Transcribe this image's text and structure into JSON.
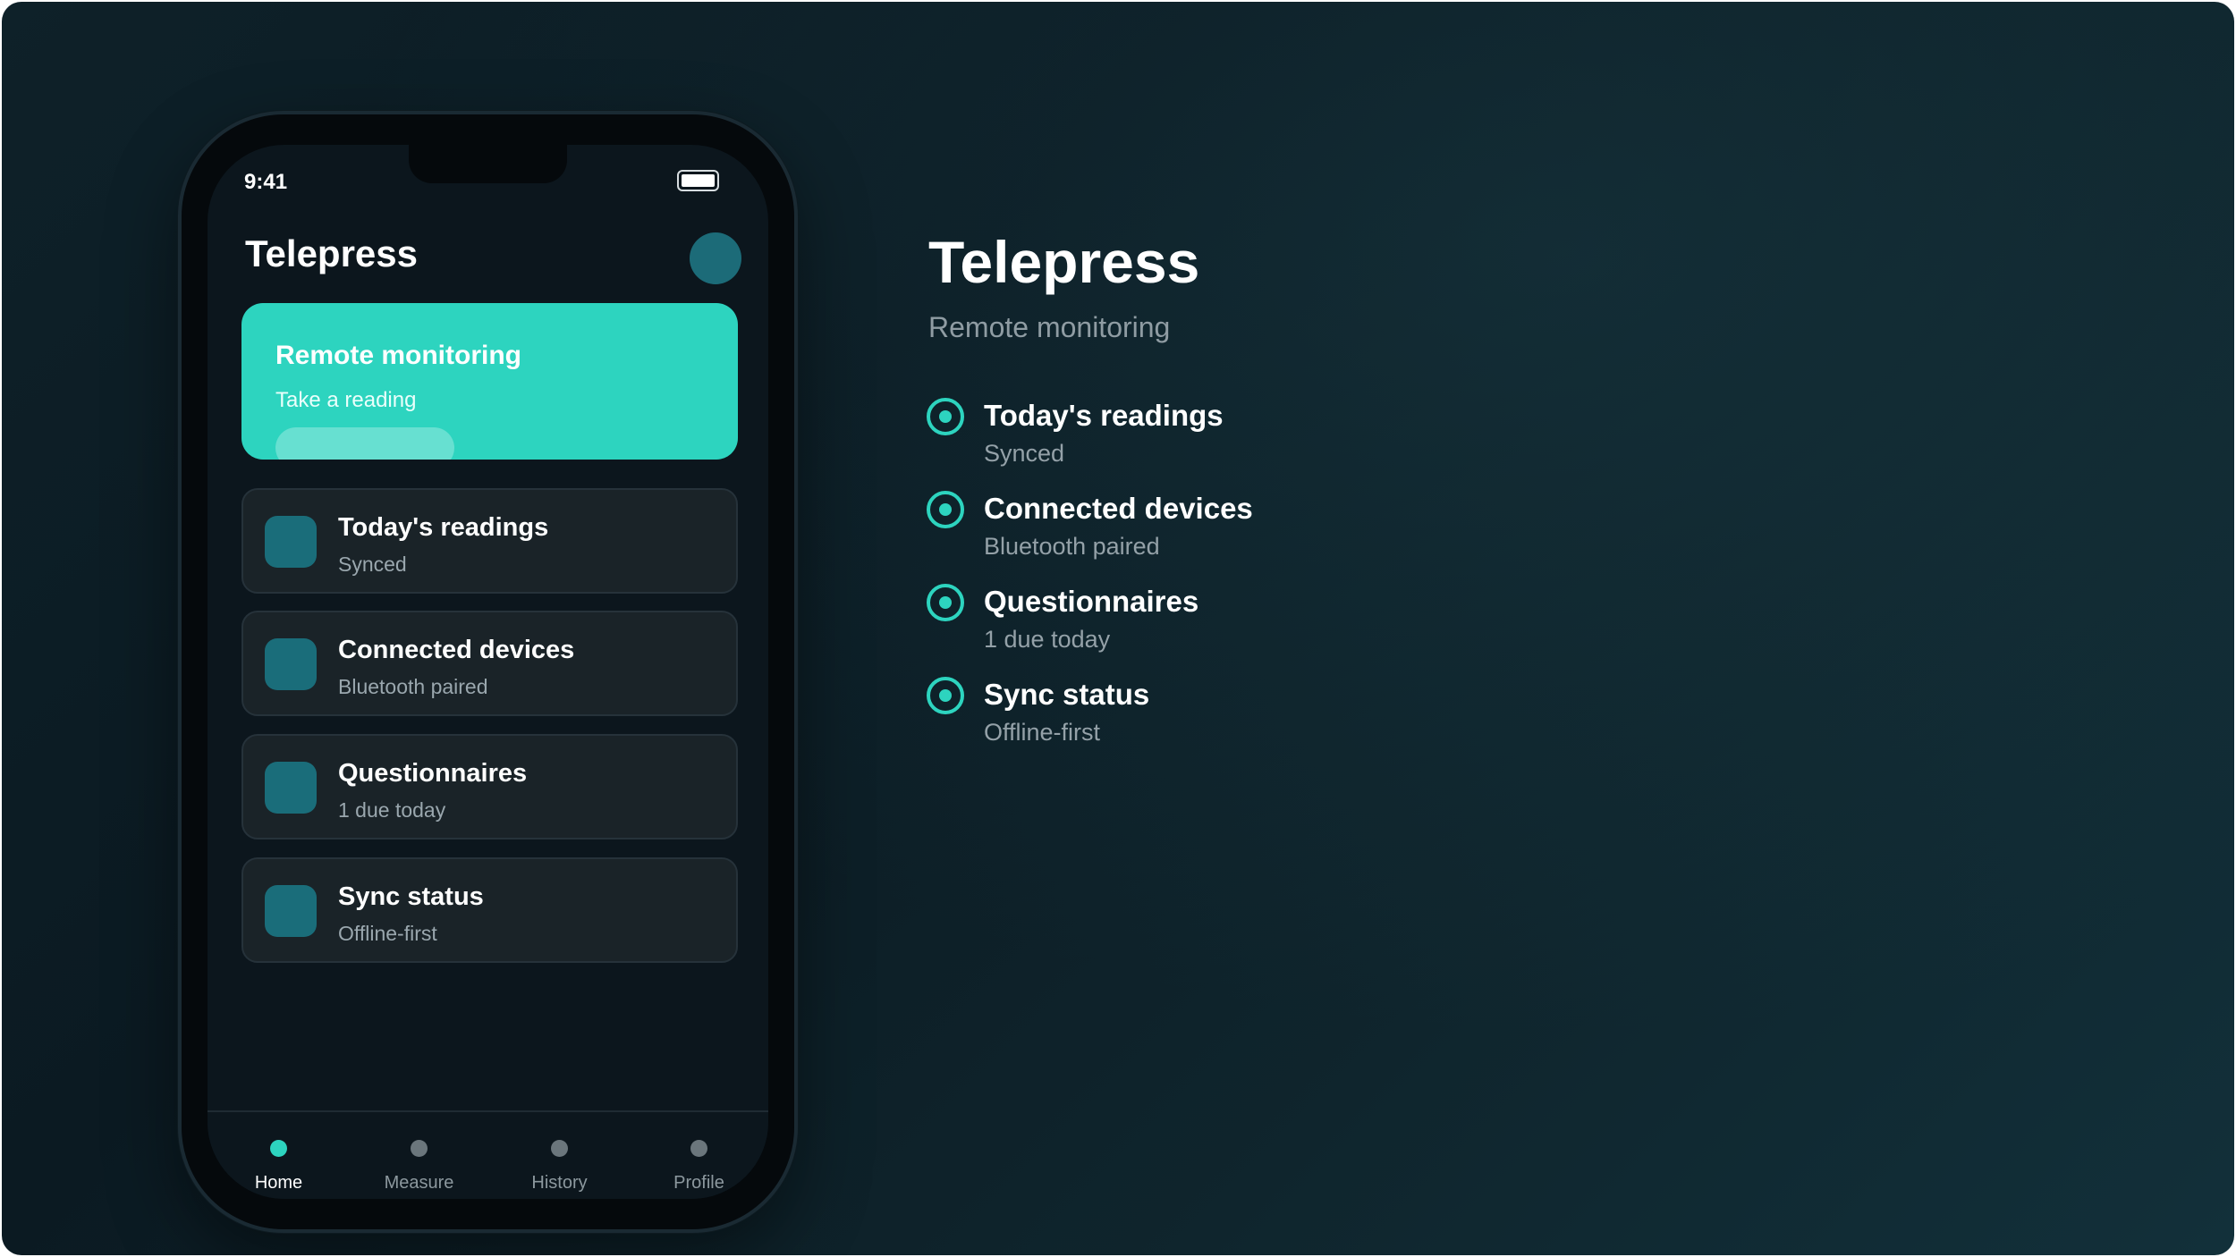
{
  "colors": {
    "accent": "#2dd4bf",
    "icon_tile": "#1a6d7a",
    "background": "#0e2129",
    "card": "#1a2328"
  },
  "phone": {
    "status_time": "9:41",
    "app_title": "Telepress",
    "hero": {
      "title": "Remote monitoring",
      "subtitle": "Take a reading"
    },
    "cards": [
      {
        "title": "Today's readings",
        "subtitle": "Synced",
        "icon": "readings-icon"
      },
      {
        "title": "Connected devices",
        "subtitle": "Bluetooth paired",
        "icon": "devices-icon"
      },
      {
        "title": "Questionnaires",
        "subtitle": "1 due today",
        "icon": "questionnaire-icon"
      },
      {
        "title": "Sync status",
        "subtitle": "Offline-first",
        "icon": "sync-icon"
      }
    ],
    "tabs": [
      {
        "label": "Home",
        "active": true
      },
      {
        "label": "Measure",
        "active": false
      },
      {
        "label": "History",
        "active": false
      },
      {
        "label": "Profile",
        "active": false
      }
    ]
  },
  "side": {
    "title": "Telepress",
    "subtitle": "Remote monitoring",
    "features": [
      {
        "title": "Today's readings",
        "subtitle": "Synced"
      },
      {
        "title": "Connected devices",
        "subtitle": "Bluetooth paired"
      },
      {
        "title": "Questionnaires",
        "subtitle": "1 due today"
      },
      {
        "title": "Sync status",
        "subtitle": "Offline-first"
      }
    ]
  }
}
